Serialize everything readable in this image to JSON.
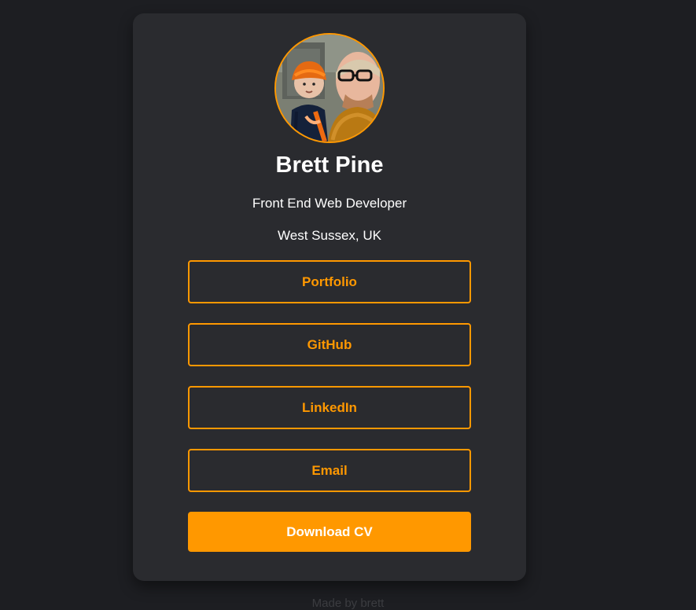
{
  "profile": {
    "avatar_alt": "profile-photo",
    "name": "Brett Pine",
    "role": "Front End Web Developer",
    "location": "West Sussex, UK"
  },
  "links": {
    "portfolio": "Portfolio",
    "github": "GitHub",
    "linkedin": "LinkedIn",
    "email": "Email",
    "download_cv": "Download CV"
  },
  "footer": {
    "text": "Made by brett"
  },
  "colors": {
    "page_bg": "#1d1e22",
    "card_bg": "#2a2b2f",
    "accent": "#ff9800",
    "text": "#ffffff"
  }
}
